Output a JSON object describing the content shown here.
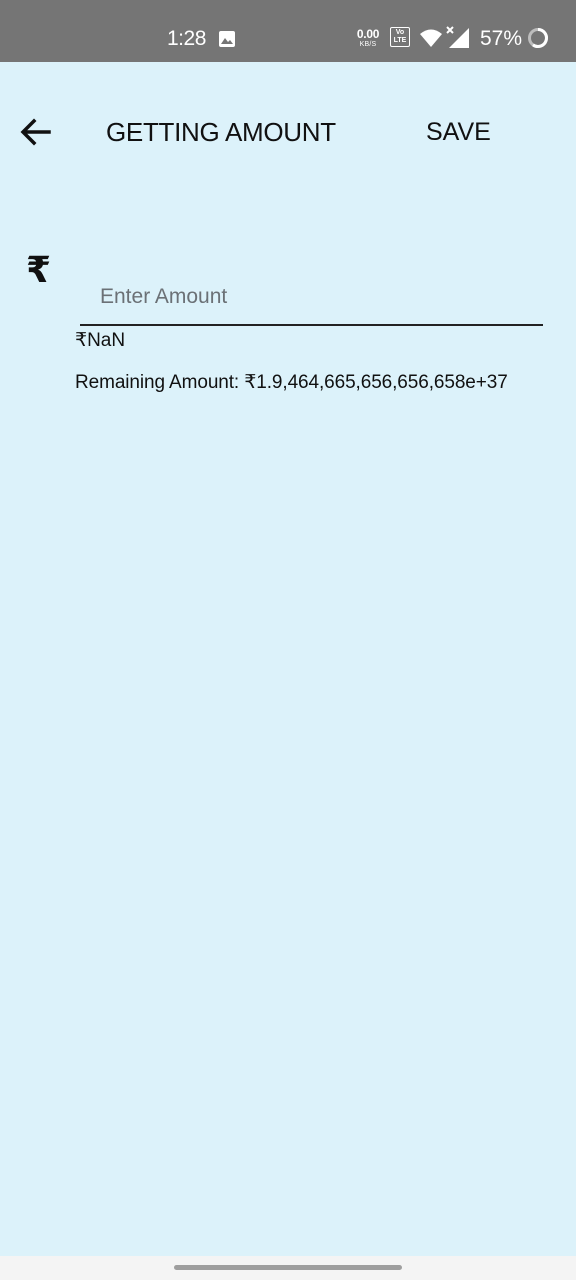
{
  "status_bar": {
    "time": "1:28",
    "net_speed_value": "0.00",
    "net_speed_unit": "KB/S",
    "volte_label": "Vo LTE",
    "battery_percent": "57%",
    "icons": [
      "gallery-icon",
      "volte-icon",
      "wifi-icon",
      "signal-icon",
      "battery-icon"
    ]
  },
  "toolbar": {
    "back_icon": "arrow-left-icon",
    "title": "GETTING AMOUNT",
    "save_label": "SAVE"
  },
  "form": {
    "currency_symbol": "₹",
    "amount_placeholder": "Enter Amount",
    "amount_value": "",
    "converted_text": "₹NaN",
    "remaining_text": "Remaining Amount: ₹1.9,464,665,656,656,658e+37"
  },
  "colors": {
    "background": "#dcf2fa",
    "status_bar": "#757575",
    "text": "#111111",
    "placeholder": "#6b7176"
  }
}
